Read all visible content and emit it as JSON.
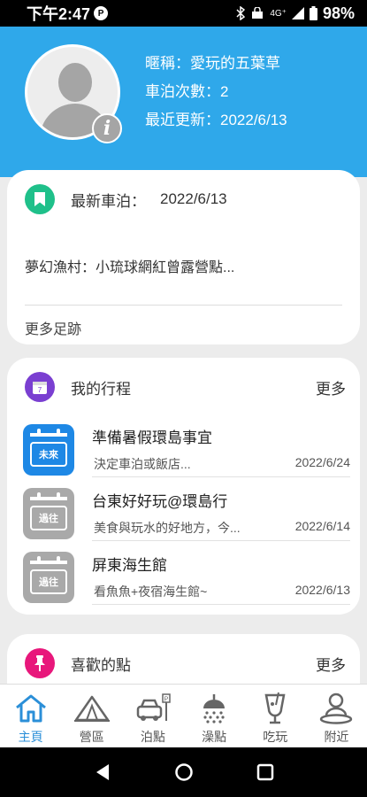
{
  "status_bar": {
    "time": "下午2:47",
    "tile": "P",
    "net": "4G⁺",
    "battery": "98%"
  },
  "profile": {
    "nickname": "暱稱：愛玩的五葉草",
    "count": "車泊次數：2",
    "updated": "最近更新：2022/6/13"
  },
  "latest": {
    "title": "最新車泊：",
    "date": "2022/6/13",
    "text": "夢幻漁村：小琉球網紅曾露營點...",
    "more": "更多足跡"
  },
  "trips": {
    "title": "我的行程",
    "more": "更多",
    "items": [
      {
        "title": "準備暑假環島事宜",
        "desc": "決定車泊或飯店...",
        "date": "2022/6/24",
        "badge": "未來",
        "color": "#1e88e5"
      },
      {
        "title": "台東好好玩@環島行",
        "desc": "美食與玩水的好地方，今...",
        "date": "2022/6/14",
        "badge": "過往",
        "color": "#a9a9a9"
      },
      {
        "title": "屏東海生館",
        "desc": "看魚魚+夜宿海生館~",
        "date": "2022/6/13",
        "badge": "過往",
        "color": "#a9a9a9"
      }
    ]
  },
  "favorites": {
    "title": "喜歡的點",
    "more": "更多"
  },
  "nav": [
    "主頁",
    "營區",
    "泊點",
    "澡點",
    "吃玩",
    "附近"
  ],
  "colors": {
    "header": "#2fa8ea",
    "active": "#2b8fd8",
    "bookmark": "#1fc08a",
    "calendar": "#7a3fd1",
    "pin": "#e8177b"
  }
}
